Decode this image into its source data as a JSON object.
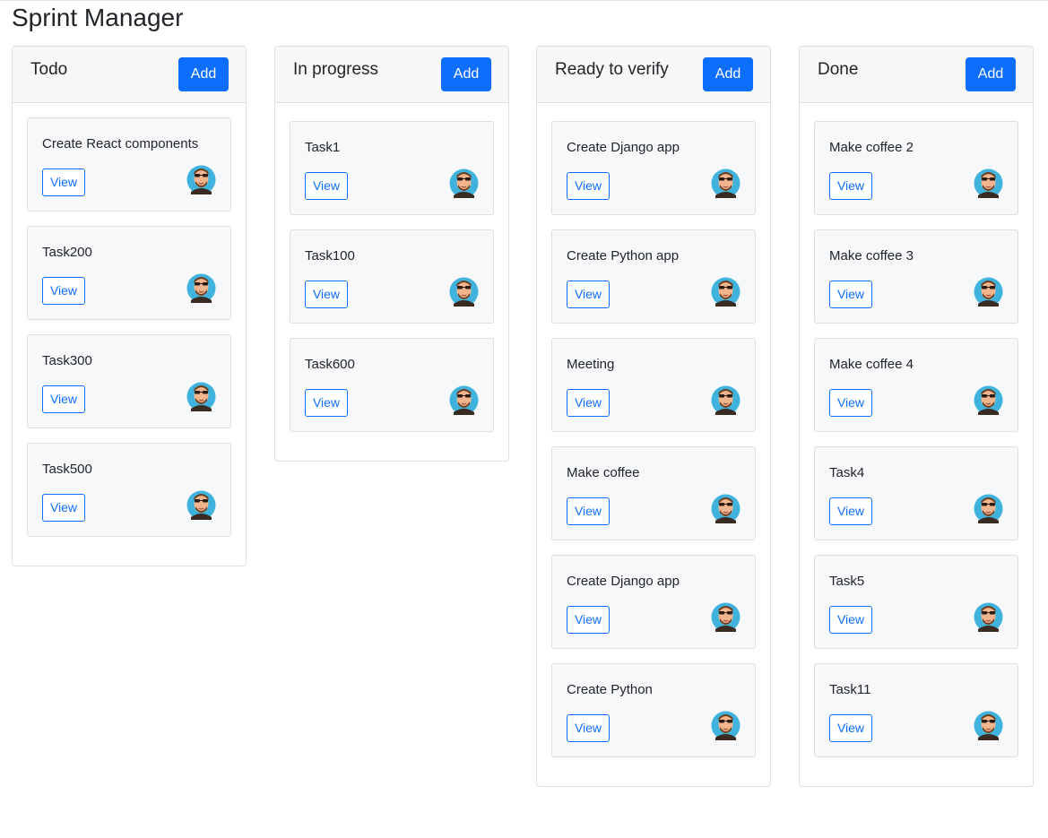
{
  "app": {
    "title": "Sprint Manager"
  },
  "labels": {
    "add": "Add",
    "view": "View"
  },
  "colors": {
    "primary": "#0d6efd",
    "header_bg": "#f7f7f7",
    "card_bg": "#f7f8fa",
    "avatar_bg": "#3fb3dd"
  },
  "avatar_icon": "user-avatar-icon",
  "columns": [
    {
      "title": "Todo",
      "cards": [
        {
          "title": "Create React components"
        },
        {
          "title": "Task200"
        },
        {
          "title": "Task300"
        },
        {
          "title": "Task500"
        }
      ]
    },
    {
      "title": "In progress",
      "cards": [
        {
          "title": "Task1"
        },
        {
          "title": "Task100"
        },
        {
          "title": "Task600"
        }
      ]
    },
    {
      "title": "Ready to verify",
      "cards": [
        {
          "title": "Create Django app"
        },
        {
          "title": "Create Python app"
        },
        {
          "title": "Meeting"
        },
        {
          "title": "Make coffee"
        },
        {
          "title": "Create Django app"
        },
        {
          "title": "Create Python"
        }
      ]
    },
    {
      "title": "Done",
      "cards": [
        {
          "title": "Make coffee 2"
        },
        {
          "title": "Make coffee 3"
        },
        {
          "title": "Make coffee 4"
        },
        {
          "title": "Task4"
        },
        {
          "title": "Task5"
        },
        {
          "title": "Task11"
        }
      ]
    }
  ]
}
